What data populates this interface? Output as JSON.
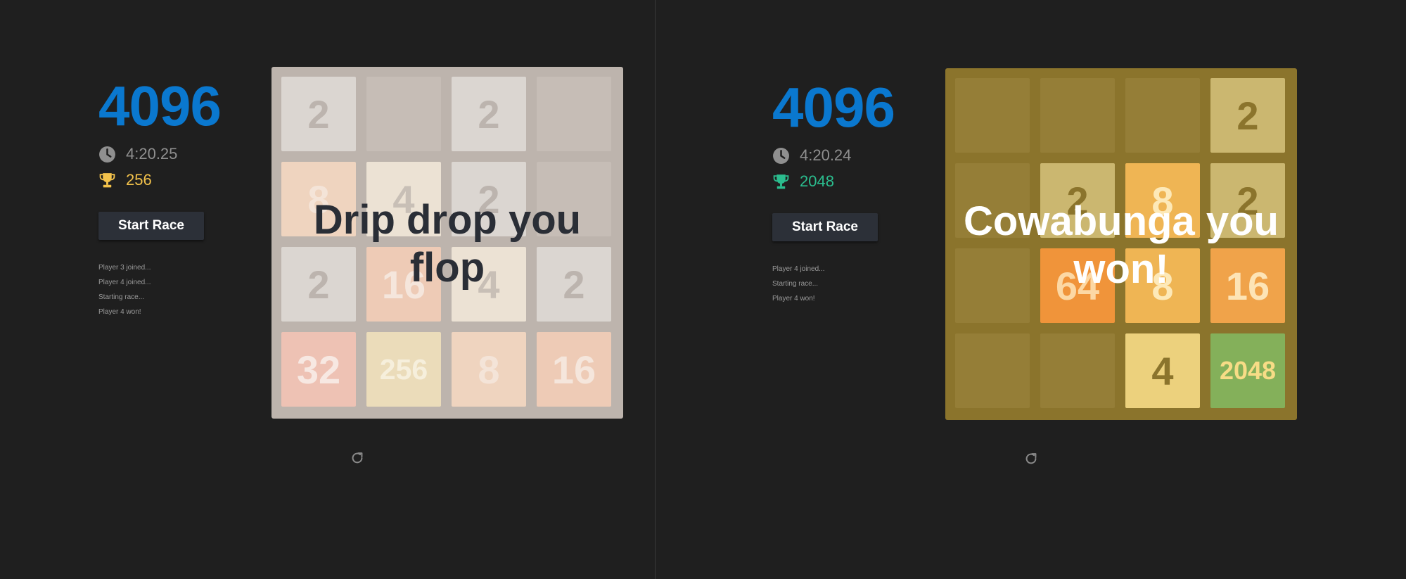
{
  "colors": {
    "goal": "#0a78cf",
    "trophy_left": "#f3c24b",
    "trophy_right": "#2bbd8e",
    "win_overlay_text": "#ffffff",
    "lose_overlay_text": "#2a2e36"
  },
  "players": [
    {
      "goal": "4096",
      "time": "4:20.25",
      "best_tile": "256",
      "start_label": "Start Race",
      "log": [
        "Player 3 joined...",
        "Player 4 joined...",
        "Starting race...",
        "Player 4 won!"
      ],
      "overlay": [
        "Drip drop you",
        "flop"
      ],
      "grid": [
        [
          "2",
          "",
          "2",
          ""
        ],
        [
          "8",
          "4",
          "2",
          ""
        ],
        [
          "2",
          "16",
          "4",
          "2"
        ],
        [
          "32",
          "256",
          "8",
          "16"
        ]
      ]
    },
    {
      "goal": "4096",
      "time": "4:20.24",
      "best_tile": "2048",
      "start_label": "Start Race",
      "log": [
        "Player 4 joined...",
        "Starting race...",
        "Player 4 won!"
      ],
      "overlay": [
        "Cowabunga you",
        "won!"
      ],
      "grid": [
        [
          "",
          "",
          "",
          "2"
        ],
        [
          "",
          "2",
          "8",
          "2"
        ],
        [
          "",
          "64",
          "8",
          "16"
        ],
        [
          "",
          "",
          "4",
          "2048"
        ]
      ]
    }
  ]
}
